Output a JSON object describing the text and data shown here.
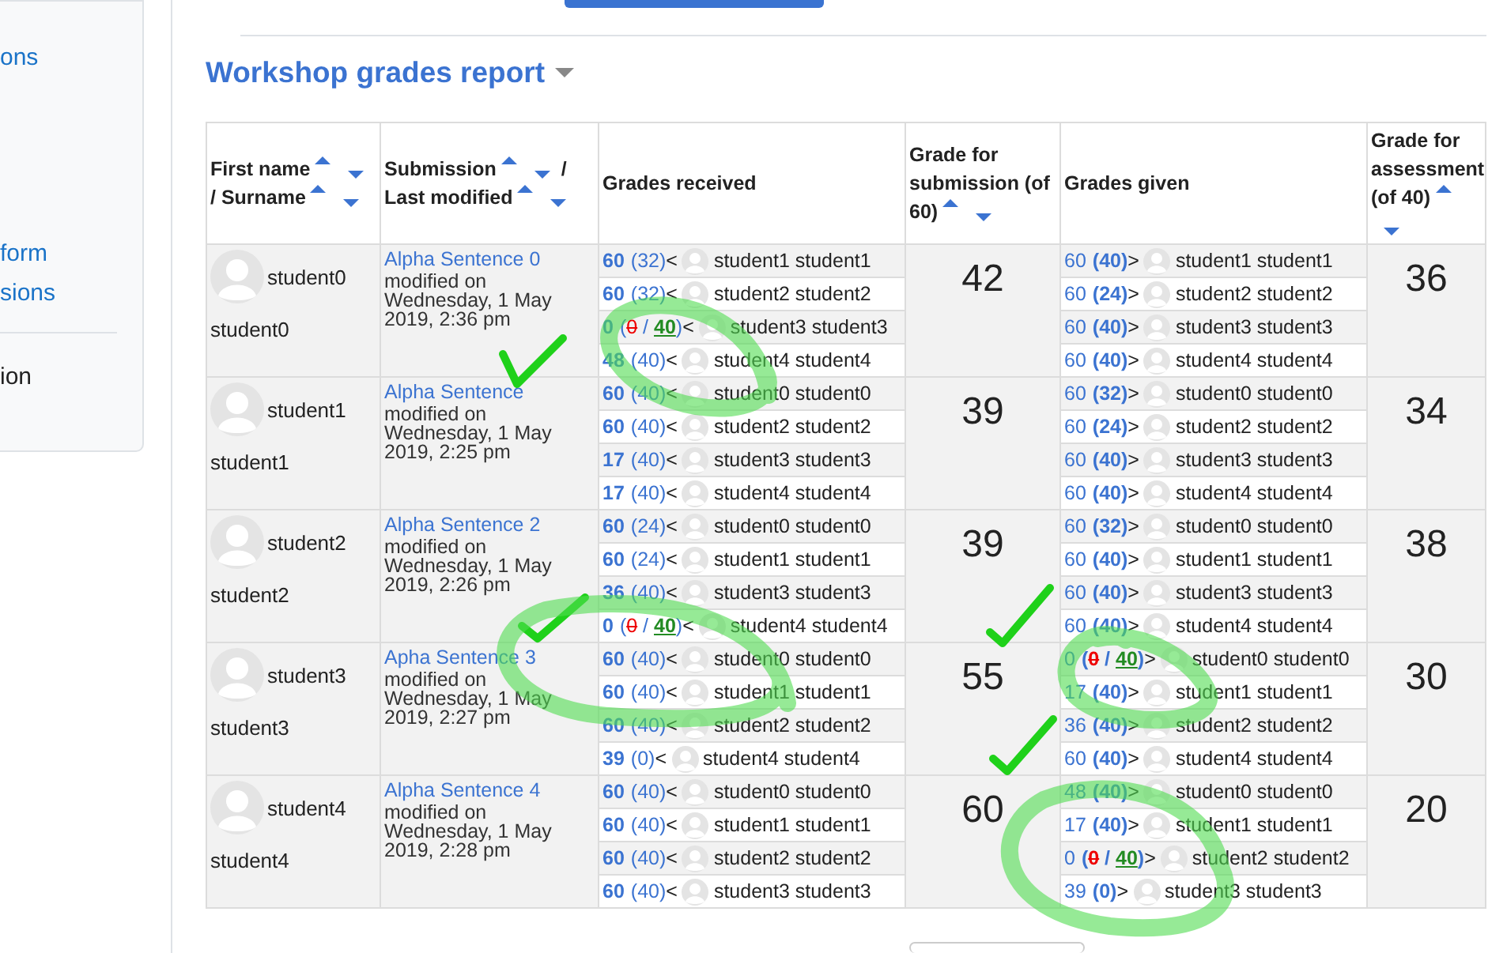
{
  "sidebar": {
    "items": [
      {
        "kind": "link",
        "label": "ons"
      },
      {
        "kind": "link",
        "label": "form"
      },
      {
        "kind": "link",
        "label": "sions"
      },
      {
        "kind": "divider"
      },
      {
        "kind": "plain",
        "label": "ion"
      }
    ]
  },
  "page_title": "Workshop grades report",
  "table": {
    "columns": [
      {
        "fields": [
          {
            "kind": "sort_field",
            "label": "First name"
          },
          {
            "kind": "sort_field",
            "label": "/ Surname"
          }
        ]
      },
      {
        "fields": [
          {
            "kind": "sort_field",
            "label": "Submission"
          },
          {
            "kind": "separator",
            "label": "/"
          },
          {
            "kind": "sort_field",
            "label": "Last modified"
          }
        ]
      },
      {
        "fields": [
          {
            "kind": "field",
            "label": "Grades received"
          }
        ]
      },
      {
        "fields": [
          {
            "kind": "sort_field",
            "label": "Grade for submission (of 60)"
          }
        ]
      },
      {
        "fields": [
          {
            "kind": "field",
            "label": "Grades given"
          }
        ]
      },
      {
        "fields": [
          {
            "kind": "sort_field",
            "label": "Grade for assessment (of 40)"
          }
        ]
      }
    ],
    "rows": [
      {
        "first_name": "student0",
        "surname": "student0",
        "submission": {
          "title": "Alpha Sentence 0",
          "modified": "modified on Wednesday, 1 May 2019, 2:36 pm"
        },
        "received": [
          {
            "kind": "plain",
            "grade": "60",
            "assessment": "(32)",
            "arrow": "<",
            "name": "student1 student1"
          },
          {
            "kind": "plain",
            "grade": "60",
            "assessment": "(32)",
            "arrow": "<",
            "name": "student2 student2"
          },
          {
            "kind": "override",
            "grade": "0",
            "assessment_parts": [
              "(",
              "0",
              "/",
              "40",
              ")"
            ],
            "arrow": "<",
            "name": "student3 student3"
          },
          {
            "kind": "plain",
            "grade": "48",
            "assessment": "(40)",
            "arrow": "<",
            "name": "student4 student4"
          }
        ],
        "grade_for_submission": "42",
        "given": [
          {
            "kind": "plain",
            "grade": "60",
            "assessment": "(40)",
            "arrow": ">",
            "name": "student1 student1"
          },
          {
            "kind": "plain",
            "grade": "60",
            "assessment": "(24)",
            "arrow": ">",
            "name": "student2 student2"
          },
          {
            "kind": "plain",
            "grade": "60",
            "assessment": "(40)",
            "arrow": ">",
            "name": "student3 student3"
          },
          {
            "kind": "plain",
            "grade": "60",
            "assessment": "(40)",
            "arrow": ">",
            "name": "student4 student4"
          }
        ],
        "grade_for_assessment": "36"
      },
      {
        "first_name": "student1",
        "surname": "student1",
        "submission": {
          "title": "Alpha Sentence",
          "modified": "modified on Wednesday, 1 May 2019, 2:25 pm"
        },
        "received": [
          {
            "kind": "plain",
            "grade": "60",
            "assessment": "(40)",
            "arrow": "<",
            "name": "student0 student0"
          },
          {
            "kind": "plain",
            "grade": "60",
            "assessment": "(40)",
            "arrow": "<",
            "name": "student2 student2"
          },
          {
            "kind": "plain",
            "grade": "17",
            "assessment": "(40)",
            "arrow": "<",
            "name": "student3 student3"
          },
          {
            "kind": "plain",
            "grade": "17",
            "assessment": "(40)",
            "arrow": "<",
            "name": "student4 student4"
          }
        ],
        "grade_for_submission": "39",
        "given": [
          {
            "kind": "plain",
            "grade": "60",
            "assessment": "(32)",
            "arrow": ">",
            "name": "student0 student0"
          },
          {
            "kind": "plain",
            "grade": "60",
            "assessment": "(24)",
            "arrow": ">",
            "name": "student2 student2"
          },
          {
            "kind": "plain",
            "grade": "60",
            "assessment": "(40)",
            "arrow": ">",
            "name": "student3 student3"
          },
          {
            "kind": "plain",
            "grade": "60",
            "assessment": "(40)",
            "arrow": ">",
            "name": "student4 student4"
          }
        ],
        "grade_for_assessment": "34"
      },
      {
        "first_name": "student2",
        "surname": "student2",
        "submission": {
          "title": "Alpha Sentence 2",
          "modified": "modified on Wednesday, 1 May 2019, 2:26 pm"
        },
        "received": [
          {
            "kind": "plain",
            "grade": "60",
            "assessment": "(24)",
            "arrow": "<",
            "name": "student0 student0"
          },
          {
            "kind": "plain",
            "grade": "60",
            "assessment": "(24)",
            "arrow": "<",
            "name": "student1 student1"
          },
          {
            "kind": "plain",
            "grade": "36",
            "assessment": "(40)",
            "arrow": "<",
            "name": "student3 student3"
          },
          {
            "kind": "override",
            "grade": "0",
            "assessment_parts": [
              "(",
              "0",
              "/",
              "40",
              ")"
            ],
            "arrow": "<",
            "name": "student4 student4"
          }
        ],
        "grade_for_submission": "39",
        "given": [
          {
            "kind": "plain",
            "grade": "60",
            "assessment": "(32)",
            "arrow": ">",
            "name": "student0 student0"
          },
          {
            "kind": "plain",
            "grade": "60",
            "assessment": "(40)",
            "arrow": ">",
            "name": "student1 student1"
          },
          {
            "kind": "plain",
            "grade": "60",
            "assessment": "(40)",
            "arrow": ">",
            "name": "student3 student3"
          },
          {
            "kind": "plain",
            "grade": "60",
            "assessment": "(40)",
            "arrow": ">",
            "name": "student4 student4"
          }
        ],
        "grade_for_assessment": "38"
      },
      {
        "first_name": "student3",
        "surname": "student3",
        "submission": {
          "title": "Apha Sentence 3",
          "modified": "modified on Wednesday, 1 May 2019, 2:27 pm"
        },
        "received": [
          {
            "kind": "plain",
            "grade": "60",
            "assessment": "(40)",
            "arrow": "<",
            "name": "student0 student0"
          },
          {
            "kind": "plain",
            "grade": "60",
            "assessment": "(40)",
            "arrow": "<",
            "name": "student1 student1"
          },
          {
            "kind": "plain",
            "grade": "60",
            "assessment": "(40)",
            "arrow": "<",
            "name": "student2 student2"
          },
          {
            "kind": "plain",
            "grade": "39",
            "assessment": "(0)",
            "arrow": "<",
            "name": "student4 student4"
          }
        ],
        "grade_for_submission": "55",
        "given": [
          {
            "kind": "override",
            "grade": "0",
            "assessment_parts": [
              "(",
              "0",
              "/",
              "40",
              ")"
            ],
            "arrow": ">",
            "name": "student0 student0"
          },
          {
            "kind": "plain",
            "grade": "17",
            "assessment": "(40)",
            "arrow": ">",
            "name": "student1 student1"
          },
          {
            "kind": "plain",
            "grade": "36",
            "assessment": "(40)",
            "arrow": ">",
            "name": "student2 student2"
          },
          {
            "kind": "plain",
            "grade": "60",
            "assessment": "(40)",
            "arrow": ">",
            "name": "student4 student4"
          }
        ],
        "grade_for_assessment": "30"
      },
      {
        "first_name": "student4",
        "surname": "student4",
        "submission": {
          "title": "Alpha Sentence 4",
          "modified": "modified on Wednesday, 1 May 2019, 2:28 pm"
        },
        "received": [
          {
            "kind": "plain",
            "grade": "60",
            "assessment": "(40)",
            "arrow": "<",
            "name": "student0 student0"
          },
          {
            "kind": "plain",
            "grade": "60",
            "assessment": "(40)",
            "arrow": "<",
            "name": "student1 student1"
          },
          {
            "kind": "plain",
            "grade": "60",
            "assessment": "(40)",
            "arrow": "<",
            "name": "student2 student2"
          },
          {
            "kind": "plain",
            "grade": "60",
            "assessment": "(40)",
            "arrow": "<",
            "name": "student3 student3"
          }
        ],
        "grade_for_submission": "60",
        "given": [
          {
            "kind": "plain",
            "grade": "48",
            "assessment": "(40)",
            "arrow": ">",
            "name": "student0 student0"
          },
          {
            "kind": "plain",
            "grade": "17",
            "assessment": "(40)",
            "arrow": ">",
            "name": "student1 student1"
          },
          {
            "kind": "override",
            "grade": "0",
            "assessment_parts": [
              "(",
              "0",
              "/",
              "40",
              ")"
            ],
            "arrow": ">",
            "name": "student2 student2"
          },
          {
            "kind": "plain",
            "grade": "39",
            "assessment": "(0)",
            "arrow": ">",
            "name": "student3 student3"
          }
        ],
        "grade_for_assessment": "20"
      }
    ]
  }
}
